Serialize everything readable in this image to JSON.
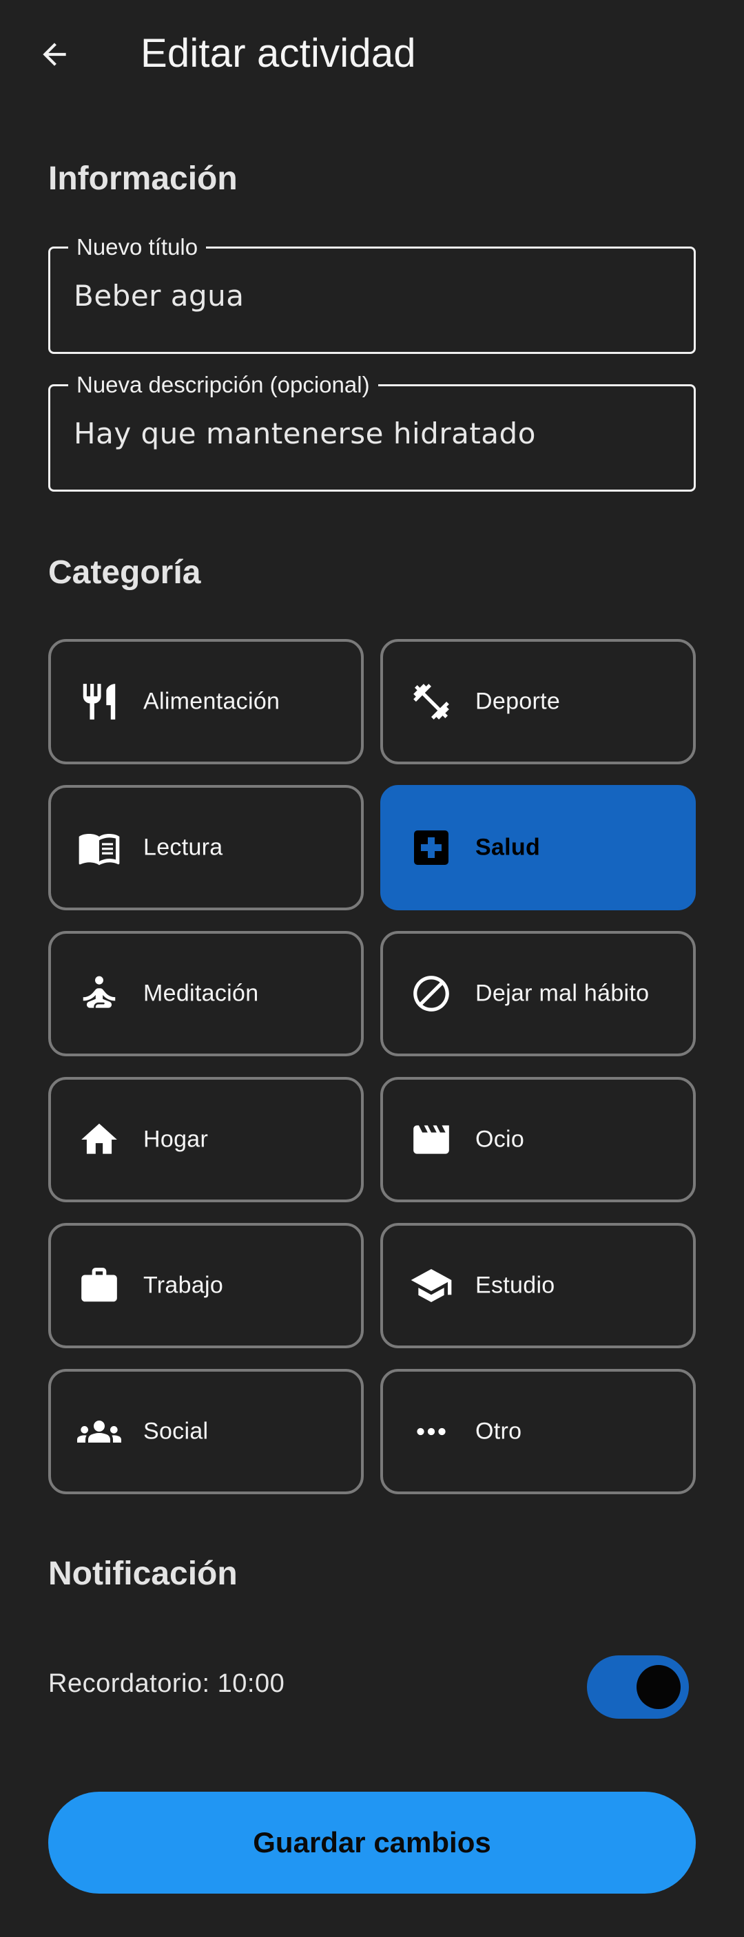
{
  "app_bar": {
    "title": "Editar actividad",
    "back_icon": "arrow-back-icon"
  },
  "info_section": {
    "title": "Información",
    "title_field": {
      "label": "Nuevo título",
      "value": "Beber agua"
    },
    "description_field": {
      "label": "Nueva descripción (opcional)",
      "value": "Hay que mantenerse hidratado"
    }
  },
  "category_section": {
    "title": "Categoría",
    "selected": "Salud",
    "items": [
      {
        "label": "Alimentación",
        "icon": "restaurant-icon"
      },
      {
        "label": "Deporte",
        "icon": "fitness-icon"
      },
      {
        "label": "Lectura",
        "icon": "book-icon"
      },
      {
        "label": "Salud",
        "icon": "medical-icon"
      },
      {
        "label": "Meditación",
        "icon": "meditation-icon"
      },
      {
        "label": "Dejar mal hábito",
        "icon": "block-icon"
      },
      {
        "label": "Hogar",
        "icon": "home-icon"
      },
      {
        "label": "Ocio",
        "icon": "movie-icon"
      },
      {
        "label": "Trabajo",
        "icon": "work-icon"
      },
      {
        "label": "Estudio",
        "icon": "school-icon"
      },
      {
        "label": "Social",
        "icon": "groups-icon"
      },
      {
        "label": "Otro",
        "icon": "more-horiz-icon"
      }
    ]
  },
  "notification_section": {
    "title": "Notificación",
    "reminder_label": "Recordatorio: 10:00",
    "reminder_enabled": true
  },
  "save_button": {
    "label": "Guardar cambios"
  },
  "colors": {
    "background": "#212121",
    "accent": "#1565c0",
    "primary_button": "#2196f3",
    "border": "#7a7a7a"
  }
}
